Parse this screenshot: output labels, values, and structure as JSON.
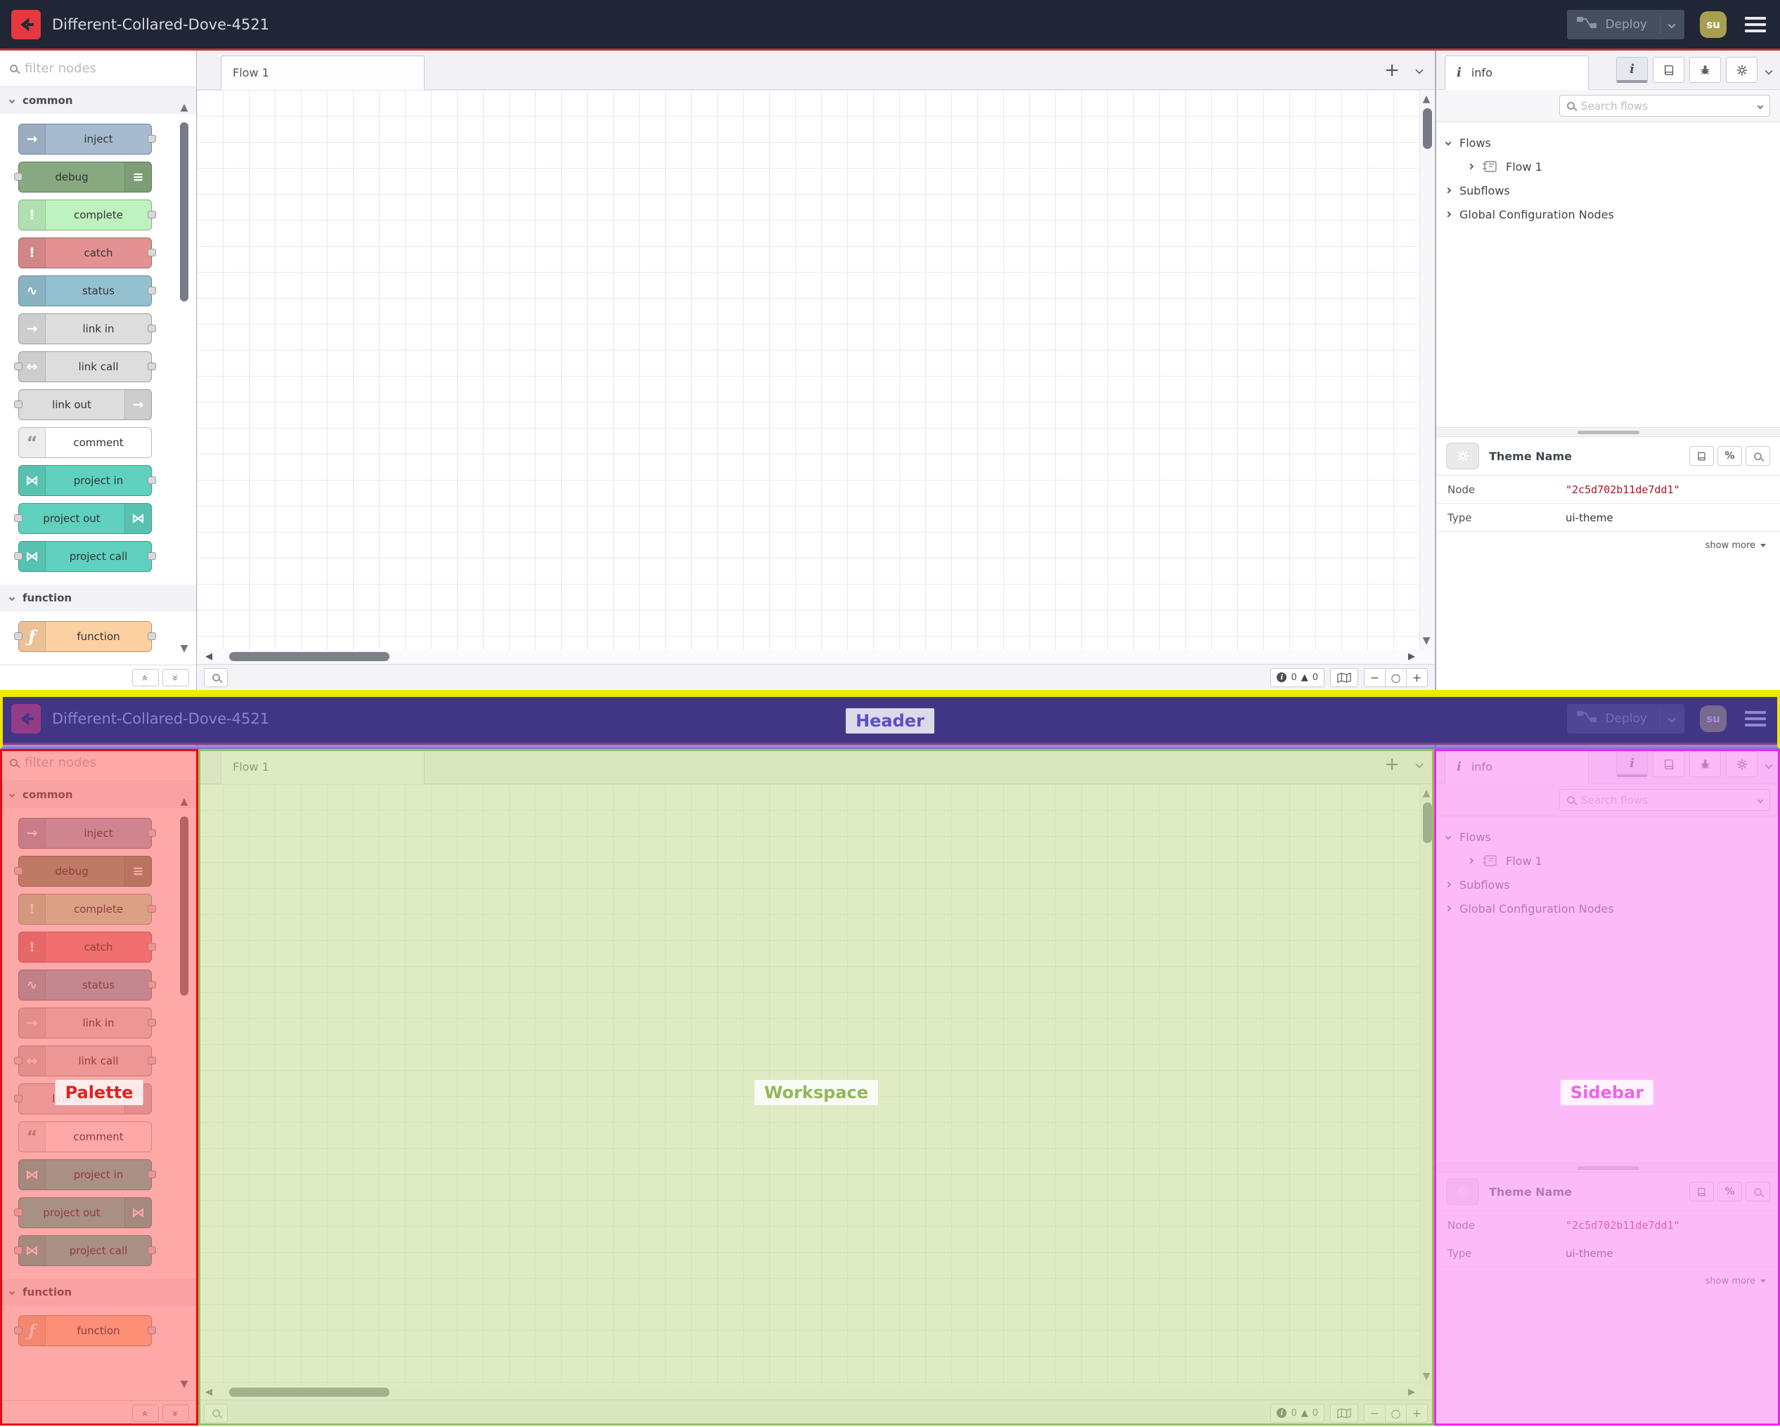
{
  "annotations": {
    "header": "Header",
    "palette": "Palette",
    "workspace": "Workspace",
    "sidebar": "Sidebar"
  },
  "header": {
    "title": "Different-Collared-Dove-4521",
    "deploy_label": "Deploy",
    "user_initials": "su"
  },
  "palette": {
    "filter_placeholder": "filter nodes",
    "sections": [
      {
        "label": "common",
        "nodes": [
          {
            "label": "inject",
            "color": "#a6bbcf",
            "icon": "inject-arrow-icon",
            "icon_side": "left",
            "ports": "out"
          },
          {
            "label": "debug",
            "color": "#87a980",
            "icon": "debug-list-icon",
            "icon_side": "right",
            "ports": "in"
          },
          {
            "label": "complete",
            "color": "#bef2be",
            "icon": "exclamation-icon",
            "icon_side": "left",
            "ports": "out"
          },
          {
            "label": "catch",
            "color": "#e49191",
            "icon": "exclamation-icon",
            "icon_side": "left",
            "ports": "out"
          },
          {
            "label": "status",
            "color": "#94c1d0",
            "icon": "pulse-icon",
            "icon_side": "left",
            "ports": "out"
          },
          {
            "label": "link in",
            "color": "#dddddd",
            "icon": "link-in-icon",
            "icon_side": "left",
            "ports": "out"
          },
          {
            "label": "link call",
            "color": "#dddddd",
            "icon": "link-call-icon",
            "icon_side": "left",
            "ports": "both"
          },
          {
            "label": "link out",
            "color": "#dddddd",
            "icon": "link-out-icon",
            "icon_side": "right",
            "ports": "in"
          },
          {
            "label": "comment",
            "color": "#ffffff",
            "icon": "comment-bubble-icon",
            "icon_side": "left",
            "ports": "none"
          },
          {
            "label": "project in",
            "color": "#5fd1be",
            "icon": "project-node-icon",
            "icon_side": "left",
            "ports": "out"
          },
          {
            "label": "project out",
            "color": "#5fd1be",
            "icon": "project-node-icon",
            "icon_side": "right",
            "ports": "in"
          },
          {
            "label": "project call",
            "color": "#5fd1be",
            "icon": "project-node-icon",
            "icon_side": "left",
            "ports": "both"
          }
        ]
      },
      {
        "label": "function",
        "nodes": [
          {
            "label": "function",
            "color": "#fdd0a2",
            "icon": "function-f-icon",
            "icon_side": "left",
            "ports": "both"
          }
        ]
      }
    ]
  },
  "workspace": {
    "tabs": [
      {
        "label": "Flow 1"
      }
    ],
    "footer": {
      "info_count": "0",
      "warning_count": "0"
    }
  },
  "sidebar": {
    "tab_label": "info",
    "search_placeholder": "Search flows",
    "tree": [
      {
        "label": "Flows",
        "level": 0,
        "expanded": true
      },
      {
        "label": "Flow 1",
        "level": 1,
        "expanded": false,
        "icon": "flow-icon"
      },
      {
        "label": "Subflows",
        "level": 0,
        "expanded": false
      },
      {
        "label": "Global Configuration Nodes",
        "level": 0,
        "expanded": false
      }
    ],
    "detail": {
      "title": "Theme Name",
      "rows": [
        {
          "key": "Node",
          "value": "\"2c5d702b11de7dd1\"",
          "value_color": "#ad1625",
          "mono": true
        },
        {
          "key": "Type",
          "value": "ui-theme"
        }
      ],
      "show_more": "show more"
    }
  },
  "colors": {
    "header_bg": "#202636",
    "header_accent": "#c5302f",
    "logo_red": "#e5383f",
    "avatar_bg": "#a89e50",
    "node_id_red": "#ad1625",
    "overlay_header": "#5842c0",
    "overlay_header_border": "#ece600",
    "overlay_palette": "#e80d0d",
    "overlay_workspace": "#96c15c",
    "overlay_sidebar": "#ef25ef"
  }
}
